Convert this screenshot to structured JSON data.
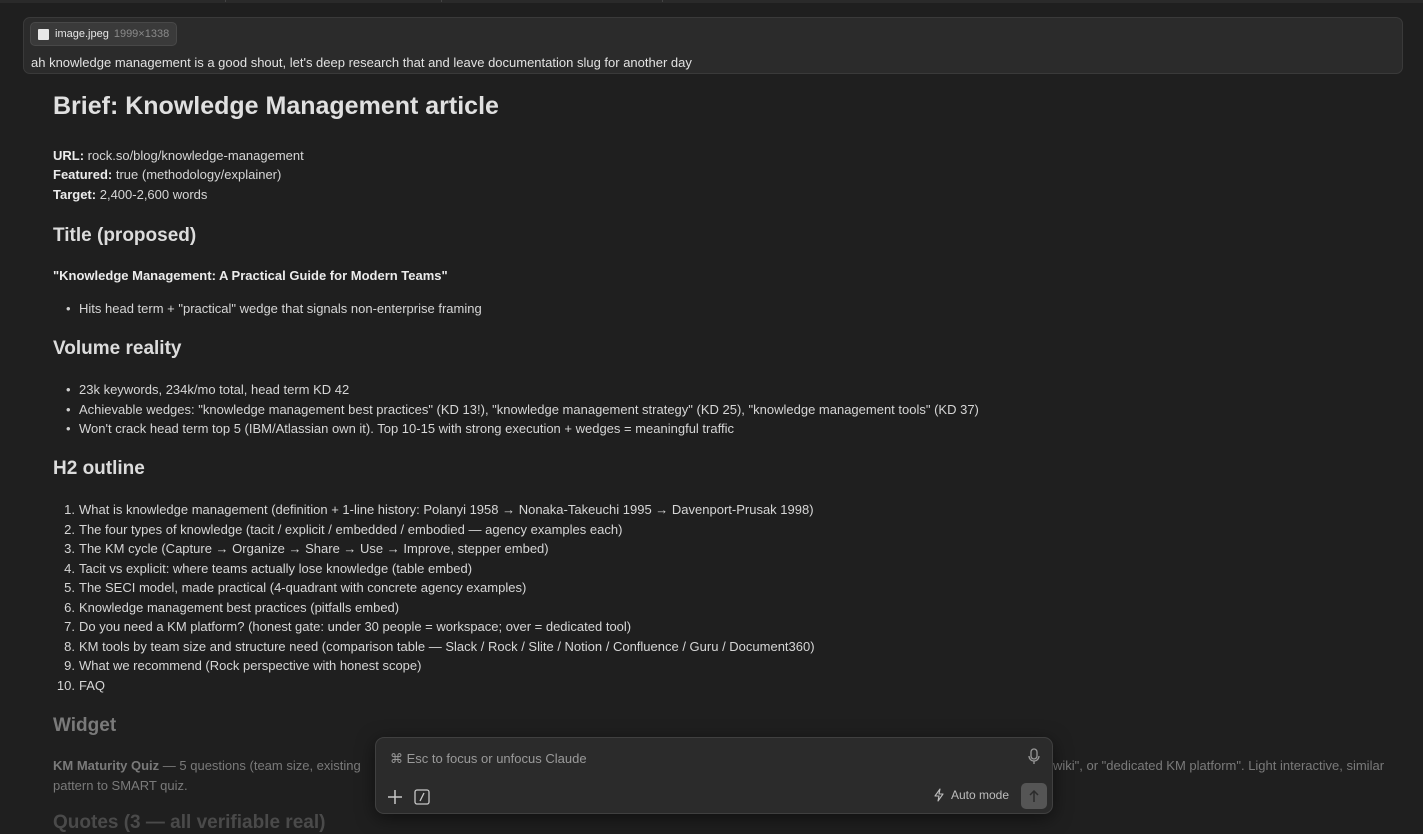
{
  "attachment": {
    "filename": "image.jpeg",
    "dimensions": "1999×1338"
  },
  "user_message": "ah knowledge management is a good shout, let's deep research that and leave documentation slug for another day",
  "brief": {
    "title": "Brief: Knowledge Management article",
    "meta": {
      "url_label": "URL:",
      "url_value": "rock.so/blog/knowledge-management",
      "featured_label": "Featured:",
      "featured_value": "true (methodology/explainer)",
      "target_label": "Target:",
      "target_value": "2,400-2,600 words"
    },
    "title_section": {
      "heading": "Title (proposed)",
      "proposed": "\"Knowledge Management: A Practical Guide for Modern Teams\"",
      "bullets": [
        "Hits head term + \"practical\" wedge that signals non-enterprise framing"
      ]
    },
    "volume": {
      "heading": "Volume reality",
      "bullets": [
        "23k keywords, 234k/mo total, head term KD 42",
        "Achievable wedges: \"knowledge management best practices\" (KD 13!), \"knowledge management strategy\" (KD 25), \"knowledge management tools\" (KD 37)",
        "Won't crack head term top 5 (IBM/Atlassian own it). Top 10-15 with strong execution + wedges = meaningful traffic"
      ]
    },
    "outline": {
      "heading": "H2 outline",
      "items": [
        "What is knowledge management (definition + 1-line history: Polanyi 1958 → Nonaka-Takeuchi 1995 → Davenport-Prusak 1998)",
        "The four types of knowledge (tacit / explicit / embedded / embodied — agency examples each)",
        "The KM cycle (Capture → Organize → Share → Use → Improve, stepper embed)",
        "Tacit vs explicit: where teams actually lose knowledge (table embed)",
        "The SECI model, made practical (4-quadrant with concrete agency examples)",
        "Knowledge management best practices (pitfalls embed)",
        "Do you need a KM platform? (honest gate: under 30 people = workspace; over = dedicated tool)",
        "KM tools by team size and structure need (comparison table — Slack / Rock / Slite / Notion / Confluence / Guru / Document360)",
        "What we recommend (Rock perspective with honest scope)",
        "FAQ"
      ]
    },
    "widget": {
      "heading": "Widget",
      "name": "KM Maturity Quiz",
      "text_left": " — 5 questions (team size, existing",
      "text_right": "wiki\", or \"dedicated KM platform\". Light interactive, similar",
      "text_line2": "pattern to SMART quiz."
    },
    "next_heading_partial": "Quotes (3 — all verifiable real)"
  },
  "composer": {
    "placeholder": "⌘ Esc to focus or unfocus Claude",
    "mode_label": "Auto mode"
  }
}
